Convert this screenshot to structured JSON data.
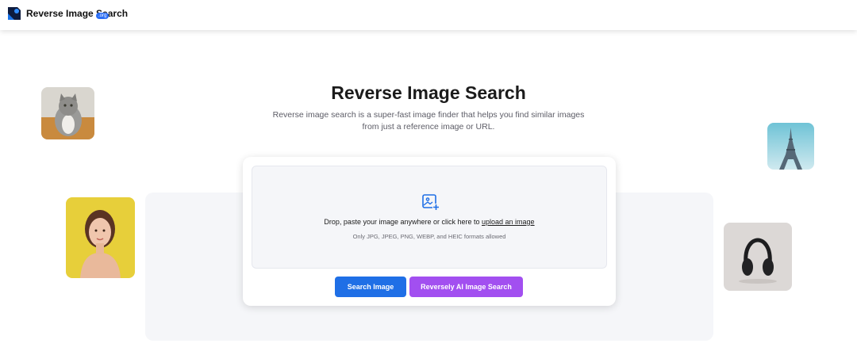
{
  "header": {
    "logo_text": "Reverse Image Search",
    "logo_badge": ".org"
  },
  "hero": {
    "title": "Reverse Image Search",
    "subtitle": "Reverse image search is a super-fast image finder that helps you find similar images from just a reference image or URL."
  },
  "upload": {
    "drop_text": "Drop, paste your image anywhere or click here to ",
    "link_text": "upload an image",
    "formats_text": "Only JPG, JPEG, PNG, WEBP, and HEIC formats allowed",
    "icon": "image-add-icon"
  },
  "buttons": {
    "search_label": "Search Image",
    "ai_label": "Reversely AI Image Search"
  },
  "colors": {
    "primary": "#1f6fe6",
    "ai_purple": "#a24ff0",
    "panel_bg": "#f5f6f9"
  },
  "example_images": [
    "cat",
    "woman",
    "eiffel-tower",
    "headphones"
  ]
}
